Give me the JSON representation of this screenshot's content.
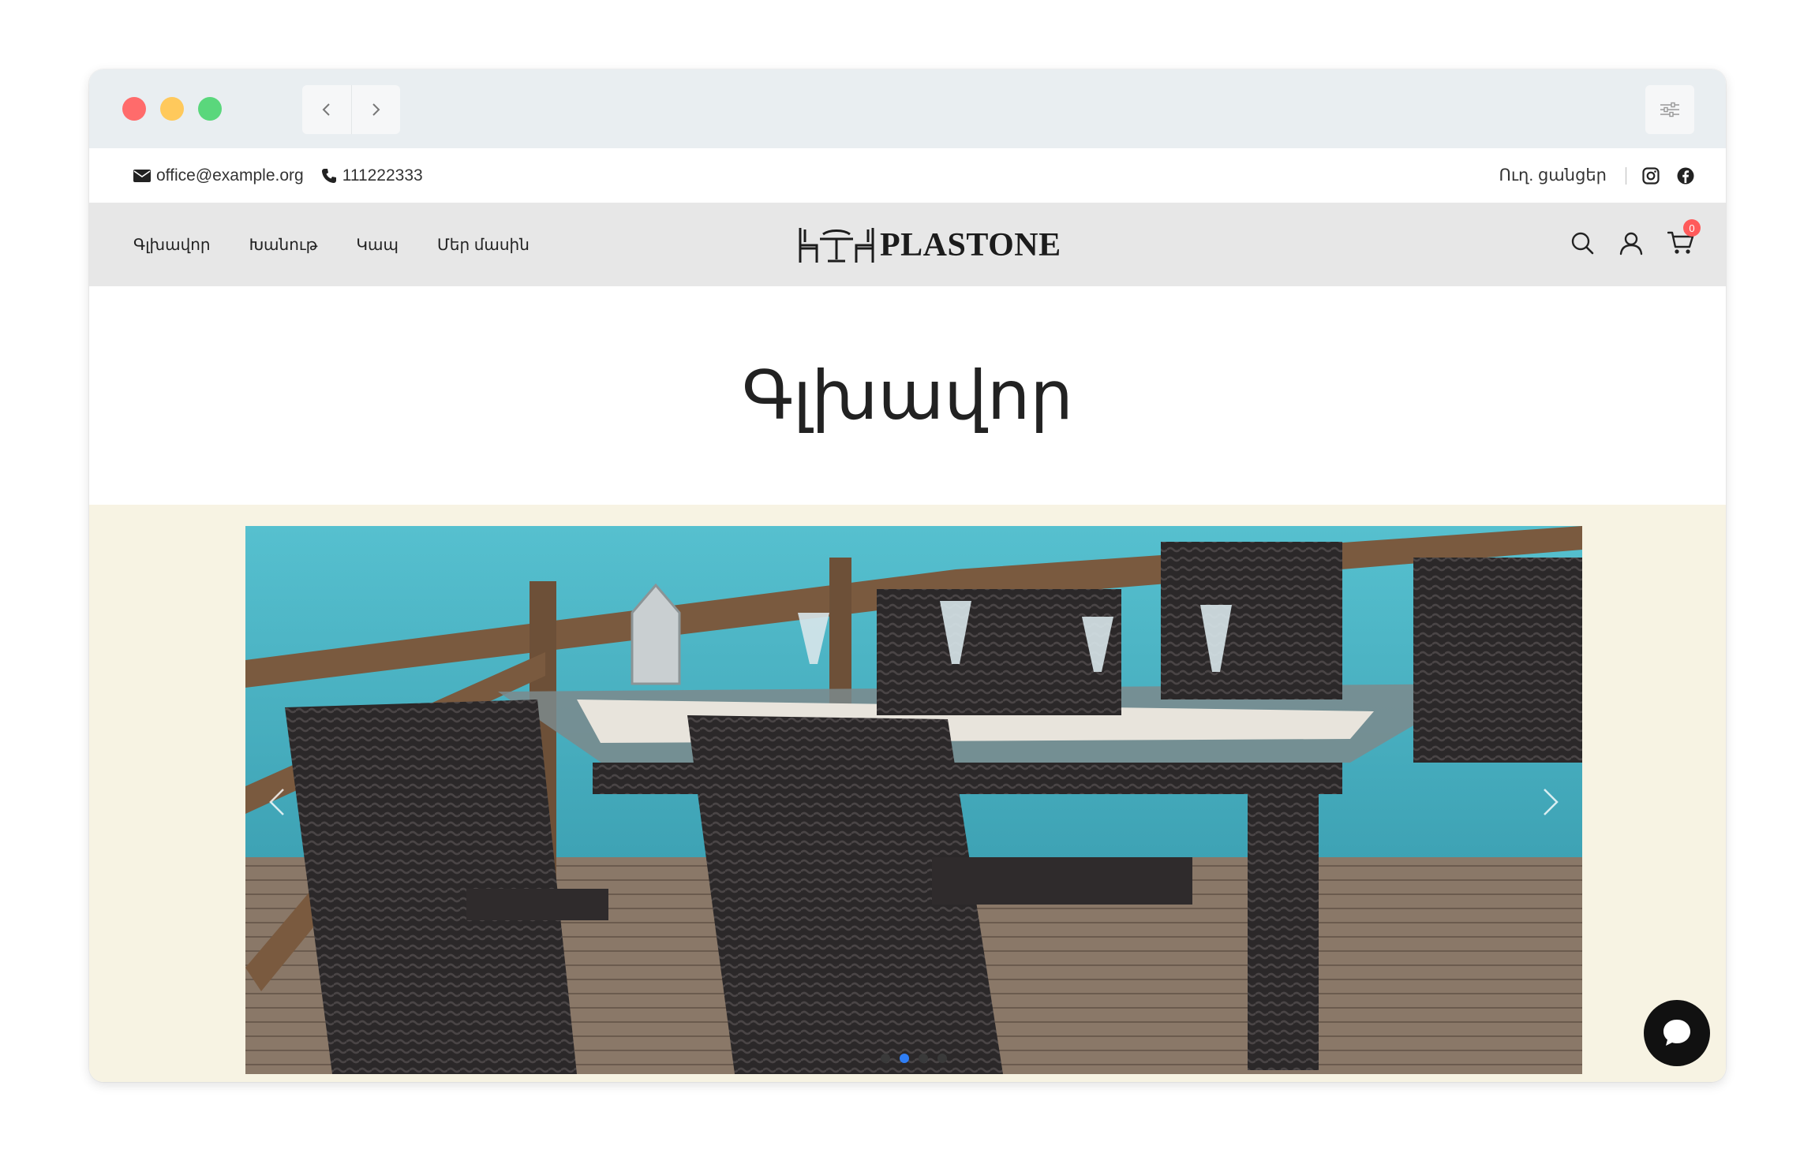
{
  "window": {
    "back_icon": "chevron-left-icon",
    "forward_icon": "chevron-right-icon",
    "settings_icon": "sliders-icon"
  },
  "topbar": {
    "email": "office@example.org",
    "phone": "111222333",
    "language": "Ուղ. ցանցեր",
    "social": [
      "instagram-icon",
      "facebook-icon"
    ]
  },
  "nav": {
    "items": [
      {
        "label": "Գլխավոր"
      },
      {
        "label": "Խանութ"
      },
      {
        "label": "Կապ"
      },
      {
        "label": "Մեր մասին"
      }
    ],
    "logo_text": "PLASTONE",
    "cart_count": "0"
  },
  "page": {
    "title": "Գլխավոր"
  },
  "slider": {
    "slide_count": 4,
    "active_index": 1,
    "image_alt": "wicker chairs and table on a seaside deck"
  },
  "colors": {
    "accent": "#2f7ef5",
    "badge": "#ff5a5a",
    "hero_bg": "#f7f3e3",
    "nav_bg": "#e7e7e7"
  }
}
